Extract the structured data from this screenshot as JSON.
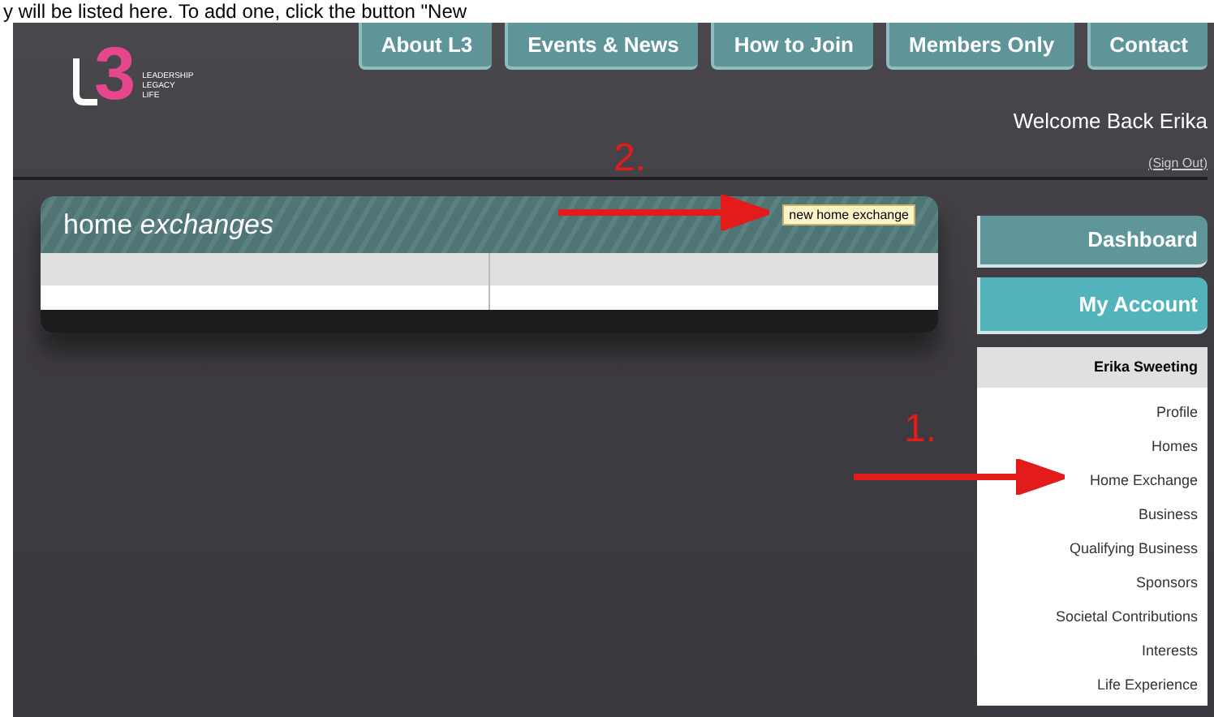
{
  "caption": "y will be listed here. To add one, click the button \"New",
  "logo": {
    "mark": "3",
    "tagline": [
      "LEADERSHIP",
      "LEGACY",
      "LIFE"
    ]
  },
  "nav_tabs": [
    "About L3",
    "Events & News",
    "How to Join",
    "Members Only",
    "Contact"
  ],
  "welcome": "Welcome Back Erika",
  "sign_out": "(Sign Out)",
  "panel": {
    "title_plain": "home ",
    "title_italic": "exchanges",
    "button": "new home exchange"
  },
  "sidebar": {
    "buttons": [
      {
        "label": "Dashboard",
        "selected": false
      },
      {
        "label": "My Account",
        "selected": true
      }
    ],
    "menu_title": "Erika Sweeting",
    "menu_items": [
      "Profile",
      "Homes",
      "Home Exchange",
      "Business",
      "Qualifying Business",
      "Sponsors",
      "Societal Contributions",
      "Interests",
      "Life Experience"
    ]
  },
  "annotations": [
    {
      "label": "2."
    },
    {
      "label": "1."
    }
  ]
}
